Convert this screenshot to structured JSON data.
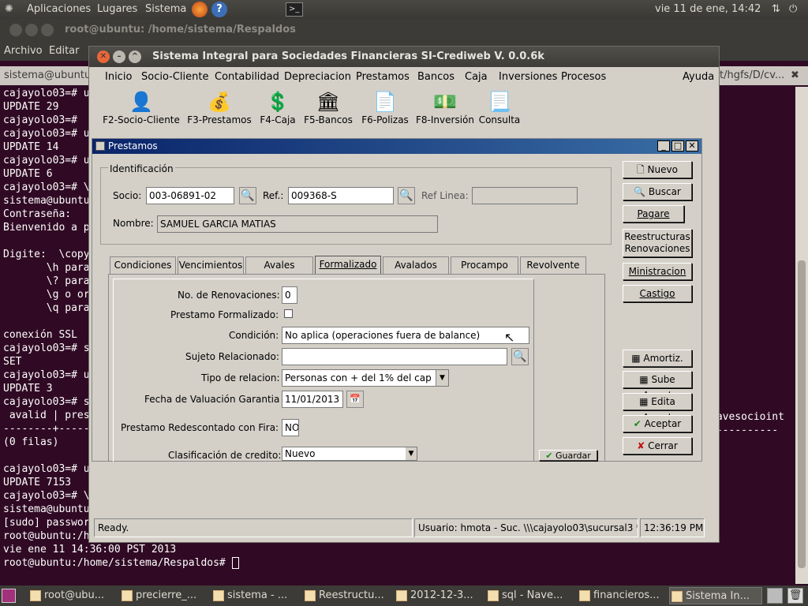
{
  "top_panel": {
    "apps": "Aplicaciones",
    "places": "Lugares",
    "system": "Sistema",
    "clock": "vie 11 de ene, 14:42"
  },
  "terminal": {
    "title": "root@ubuntu: /home/sistema/Respaldos",
    "menu": [
      "Archivo",
      "Editar",
      "Ver"
    ],
    "tab_left": "sistema@ubuntu",
    "tab_right": "t/hgfs/D/cv...",
    "lines": [
      "cajayolo03=# u",
      "UPDATE 29",
      "cajayolo03=#",
      "cajayolo03=# u",
      "UPDATE 14",
      "cajayolo03=# u",
      "UPDATE 6",
      "cajayolo03=# \\",
      "sistema@ubuntu",
      "Contraseña:",
      "Bienvenido a p",
      "",
      "Digite:  \\copy",
      "       \\h para",
      "       \\? para",
      "       \\g o or",
      "       \\q para",
      "",
      "conexión SSL",
      "cajayolo03=# s",
      "SET",
      "cajayolo03=# u",
      "UPDATE 3",
      "cajayolo03=# s",
      " avalid | pres",
      "--------+------",
      "(0 filas)",
      "",
      "cajayolo03=# u",
      "UPDATE 7153",
      "cajayolo03=# \\",
      "sistema@ubuntu",
      "[sudo] passwor",
      "root@ubuntu:/h",
      "vie ene 11 14:36:00 PST 2013",
      "root@ubuntu:/home/sistema/Respaldos# "
    ],
    "right_lines": [
      "lavesocioint",
      "-----------"
    ]
  },
  "app": {
    "title": "Sistema Integral para Sociedades Financieras SI-Crediweb V. 0.0.6k",
    "menu": [
      "Inicio",
      "Socio-Cliente",
      "Contabilidad",
      "Depreciacion",
      "Prestamos",
      "Bancos",
      "Caja",
      "Inversiones",
      "Procesos"
    ],
    "help": "Ayuda",
    "tools": [
      {
        "label": "F2-Socio-Cliente",
        "icon": "person-icon"
      },
      {
        "label": "F3-Prestamos",
        "icon": "money-bag-icon"
      },
      {
        "label": "F4-Caja",
        "icon": "cash-box-icon"
      },
      {
        "label": "F5-Bancos",
        "icon": "bank-icon"
      },
      {
        "label": "F6-Polizas",
        "icon": "document-icon"
      },
      {
        "label": "F8-Inversión",
        "icon": "banknotes-icon"
      },
      {
        "label": "Consulta",
        "icon": "paper-icon"
      }
    ]
  },
  "dialog": {
    "title": "Prestamos",
    "group_title": "Identificación",
    "socio_label": "Socio:",
    "socio_value": "003-06891-02",
    "ref_label": "Ref.:",
    "ref_value": "009368-S",
    "ref_linea_label": "Ref Linea:",
    "ref_linea_value": "",
    "nombre_label": "Nombre:",
    "nombre_value": "SAMUEL GARCIA MATIAS",
    "tabs": [
      "Condiciones",
      "Vencimientos",
      "Avales",
      "Formalizado",
      "Avalados",
      "Procampo",
      "Revolvente"
    ],
    "active_tab": "Formalizado",
    "form": {
      "renovaciones_label": "No. de Renovaciones:",
      "renovaciones_value": "0",
      "formalizado_label": "Prestamo Formalizado:",
      "condicion_label": "Condición:",
      "condicion_value": "No aplica (operaciones fuera de balance)",
      "sujeto_label": "Sujeto Relacionado:",
      "sujeto_value": "",
      "tipo_label": "Tipo de relacion:",
      "tipo_value": "Personas con + del 1% del cap",
      "fecha_label": "Fecha de Valuación Garantia",
      "fecha_value": "11/01/2013",
      "redescontado_label": "Prestamo Redescontado con Fira:",
      "redescontado_value": "NO",
      "clasificacion_label": "Clasificación de credito:",
      "clasificacion_value": "Nuevo",
      "guardar_label": "Guardar"
    },
    "buttons": {
      "nuevo": "Nuevo",
      "buscar": "Buscar",
      "pagare": "Pagare",
      "reestructuras1": "Reestructuras",
      "reestructuras2": "Renovaciones",
      "ministracion": "Ministracion",
      "castigo": "Castigo",
      "amortiz": "Amortiz.",
      "sube": "Sube Amort",
      "edita": "Edita Amort",
      "aceptar": "Aceptar",
      "cerrar": "Cerrar"
    }
  },
  "status": {
    "ready": "Ready.",
    "user": "Usuario: hmota - Suc. \\\\\\cajayolo03\\sucursal3 *",
    "time": "12:36:19 PM"
  },
  "taskbar": [
    "root@ubu...",
    "precierre_...",
    "sistema - ...",
    "Reestructu...",
    "2012-12-3...",
    "sql - Nave...",
    "financieros...",
    "Sistema In..."
  ]
}
